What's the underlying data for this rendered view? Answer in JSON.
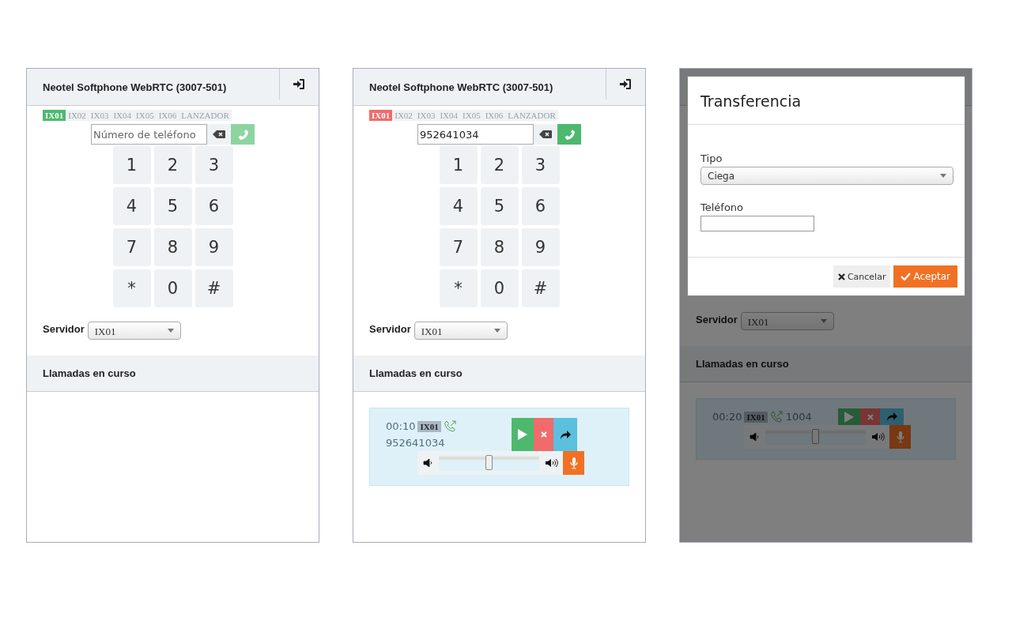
{
  "phones": [
    {
      "title": "Neotel Softphone WebRTC (3007-501)",
      "tabs": [
        {
          "label": "IX01",
          "selected": true,
          "color": "#4cb96e"
        },
        {
          "label": "IX02",
          "selected": false
        },
        {
          "label": "IX03",
          "selected": false
        },
        {
          "label": "IX04",
          "selected": false
        },
        {
          "label": "IX05",
          "selected": false
        },
        {
          "label": "IX06",
          "selected": false
        },
        {
          "label": "LANZADOR",
          "selected": false
        }
      ],
      "number": {
        "placeholder": "Número de teléfono"
      },
      "call_button": {
        "disabled": true
      },
      "keys": [
        "1",
        "2",
        "3",
        "4",
        "5",
        "6",
        "7",
        "8",
        "9",
        "*",
        "0",
        "#"
      ],
      "server": {
        "label": "Servidor",
        "value": "IX01"
      },
      "calls_heading": "Llamadas en curso"
    },
    {
      "title": "Neotel Softphone WebRTC (3007-501)",
      "tabs": [
        {
          "label": "IX01",
          "selected": true,
          "color": "#f06b6b"
        },
        {
          "label": "IX02",
          "selected": false
        },
        {
          "label": "IX03",
          "selected": false
        },
        {
          "label": "IX04",
          "selected": false
        },
        {
          "label": "IX05",
          "selected": false
        },
        {
          "label": "IX06",
          "selected": false
        },
        {
          "label": "LANZADOR",
          "selected": false
        }
      ],
      "number": {
        "value": "952641034"
      },
      "call_button": {
        "disabled": false
      },
      "keys": [
        "1",
        "2",
        "3",
        "4",
        "5",
        "6",
        "7",
        "8",
        "9",
        "*",
        "0",
        "#"
      ],
      "server": {
        "label": "Servidor",
        "value": "IX01"
      },
      "calls_heading": "Llamadas en curso",
      "calls": [
        {
          "kind": "stacked",
          "time": "00:10",
          "server": "IX01",
          "number": "952641034",
          "volume": {
            "level": 0.5
          }
        }
      ]
    },
    {
      "server": {
        "label": "Servidor",
        "value": "IX01"
      },
      "calls_heading": "Llamadas en curso",
      "calls": [
        {
          "kind": "inline",
          "time": "00:20",
          "server": "IX01",
          "number": "1004",
          "volume": {
            "level": 0.5
          }
        }
      ],
      "dialog": {
        "title": "Transferencia",
        "type_field": {
          "label": "Tipo",
          "value": "Ciega"
        },
        "phone_field": {
          "label": "Teléfono"
        },
        "buttons": [
          {
            "kind": "cancel",
            "label": "Cancelar"
          },
          {
            "kind": "accept",
            "label": "Aceptar"
          }
        ]
      }
    }
  ]
}
